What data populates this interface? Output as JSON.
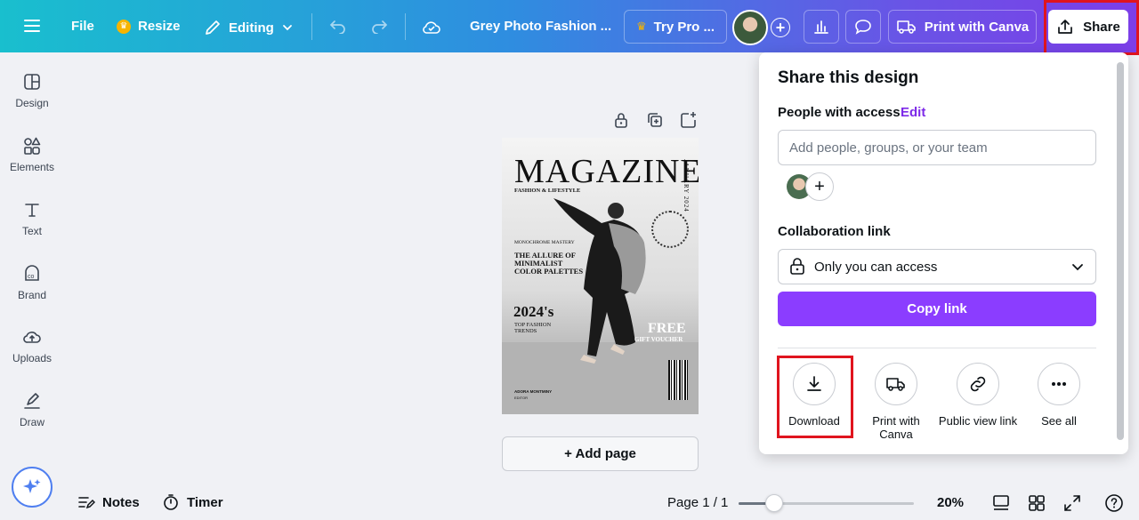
{
  "topbar": {
    "file": "File",
    "resize": "Resize",
    "editing": "Editing",
    "doc_title": "Grey Photo Fashion ...",
    "try_pro": "Try Pro ...",
    "print": "Print with Canva",
    "share": "Share"
  },
  "sidebar": {
    "items": [
      {
        "label": "Design",
        "icon": "design-icon"
      },
      {
        "label": "Elements",
        "icon": "elements-icon"
      },
      {
        "label": "Text",
        "icon": "text-icon"
      },
      {
        "label": "Brand",
        "icon": "brand-icon"
      },
      {
        "label": "Uploads",
        "icon": "uploads-icon"
      },
      {
        "label": "Draw",
        "icon": "draw-icon"
      }
    ]
  },
  "magazine": {
    "title": "MAGAZINE",
    "subtitle": "FASHION & LIFESTYLE",
    "date": "JANUARY 2024",
    "ring": "COLLECTION · COLLECTION ·",
    "kicker": "MONOCHROME MASTERY",
    "headline": "THE ALLURE OF MINIMALIST COLOR PALETTES",
    "year": "2024's",
    "year_sub": "TOP FASHION TRENDS",
    "free": "FREE",
    "free_sub": "GIFT VOUCHER",
    "name": "ADORA MONTMINY",
    "role": "EDITOR"
  },
  "canvas": {
    "add_page": "+ Add page"
  },
  "share_panel": {
    "title": "Share this design",
    "people_label": "People with access",
    "edit": "Edit",
    "input_placeholder": "Add people, groups, or your team",
    "collab_label": "Collaboration link",
    "access_value": "Only you can access",
    "copy_link": "Copy link",
    "options": [
      {
        "label": "Download",
        "icon": "download-icon"
      },
      {
        "label": "Print with Canva",
        "icon": "truck-icon"
      },
      {
        "label": "Public view link",
        "icon": "link-icon"
      },
      {
        "label": "See all",
        "icon": "more-icon"
      }
    ]
  },
  "bottom": {
    "notes": "Notes",
    "timer": "Timer",
    "page": "Page 1 / 1",
    "zoom": "20%",
    "zoom_level": 0.2
  },
  "colors": {
    "accent": "#8b3dff",
    "highlight": "#e0141e",
    "topbar_start": "#19bfce",
    "topbar_end": "#7c3ee8"
  }
}
